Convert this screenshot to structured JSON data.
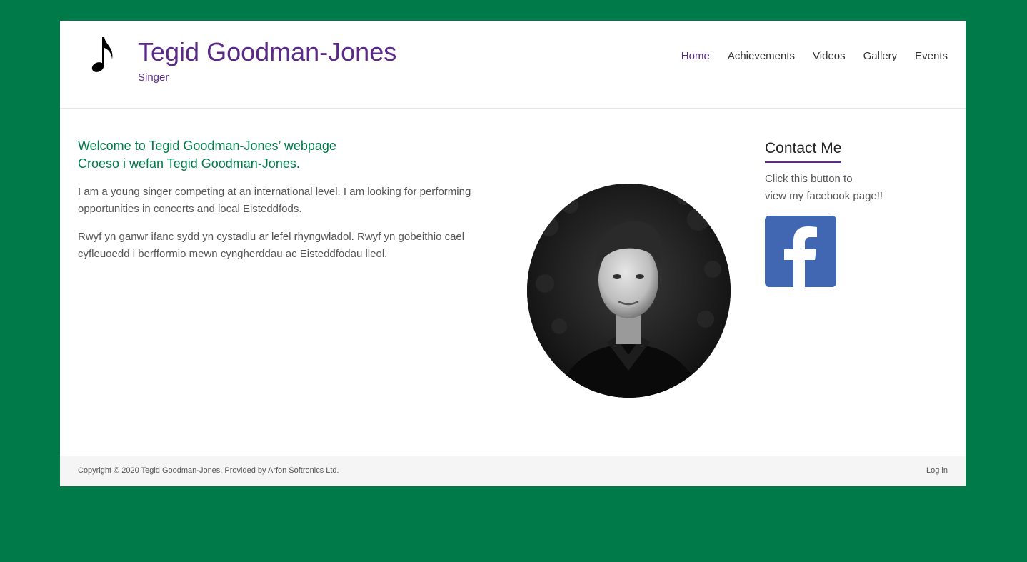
{
  "header": {
    "title": "Tegid Goodman-Jones",
    "tagline": "Singer",
    "logo_icon": "music-note-icon"
  },
  "nav": {
    "items": [
      {
        "label": "Home",
        "active": true
      },
      {
        "label": "Achievements",
        "active": false
      },
      {
        "label": "Videos",
        "active": false
      },
      {
        "label": "Gallery",
        "active": false
      },
      {
        "label": "Events",
        "active": false
      }
    ]
  },
  "main": {
    "welcome_en": "Welcome to Tegid Goodman-Jones’ webpage",
    "welcome_cy": "Croeso i wefan Tegid Goodman-Jones.",
    "para_en": "I am a young singer competing at an international level. I am looking for performing opportunities in concerts and local Eisteddfods.",
    "para_cy": "Rwyf yn ganwr ifanc sydd  yn cystadlu ar lefel rhyngwladol. Rwyf yn gobeithio cael cyfleuoedd i berfformio mewn cyngherddau ac Eisteddfodau lleol."
  },
  "sidebar": {
    "title": "Contact Me",
    "text_line1": "Click this button to",
    "text_line2": "view my facebook page!!",
    "button_icon": "facebook-icon"
  },
  "footer": {
    "copyright": "Copyright © 2020 Tegid Goodman-Jones. Provided by Arfon Softronics Ltd.",
    "login": "Log in"
  },
  "colors": {
    "background": "#007a49",
    "accent": "#5b2a86",
    "heading_green": "#007a49",
    "facebook_blue": "#4267b2"
  }
}
